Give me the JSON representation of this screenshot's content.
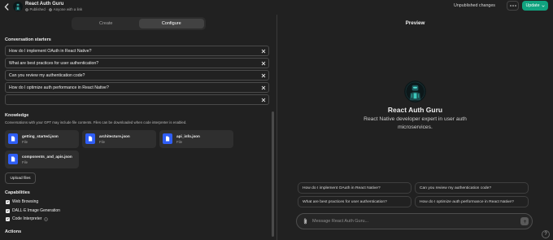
{
  "header": {
    "back_icon": "chevron-left-icon",
    "title": "React Auth Guru",
    "status": "Published",
    "separator": "·",
    "visibility": "Anyone with a link",
    "unpublished_label": "Unpublished changes",
    "more_icon": "ellipsis-icon",
    "update_label": "Update"
  },
  "tabs": [
    {
      "label": "Create",
      "active": false
    },
    {
      "label": "Configure",
      "active": true
    }
  ],
  "starters": {
    "heading": "Conversation starters",
    "items": [
      "How do I implement OAuth in React Native?",
      "What are best practices for user authentication?",
      "Can you review my authentication code?",
      "How do I optimize auth performance in React Native?",
      ""
    ]
  },
  "knowledge": {
    "heading": "Knowledge",
    "description": "Conversations with your GPT may include file contents. Files can be downloaded when code interpreter is enabled.",
    "files": [
      {
        "name": "getting_started.json",
        "type": "File"
      },
      {
        "name": "architecture.json",
        "type": "File"
      },
      {
        "name": "api_info.json",
        "type": "File"
      },
      {
        "name": "components_and_apis.json",
        "type": "File"
      }
    ],
    "upload_label": "Upload files"
  },
  "capabilities": {
    "heading": "Capabilities",
    "items": [
      {
        "label": "Web Browsing",
        "checked": true
      },
      {
        "label": "DALL·E Image Generation",
        "checked": true
      },
      {
        "label": "Code Interpreter",
        "checked": true,
        "info_icon": "info-icon"
      }
    ]
  },
  "actions": {
    "heading": "Actions"
  },
  "preview": {
    "heading": "Preview",
    "name": "React Auth Guru",
    "description": "React Native developer expert in user auth microservices.",
    "suggestions": [
      "How do I implement OAuth in React Native?",
      "Can you review my authentication code?",
      "What are best practices for user authentication?",
      "How do I optimize auth performance in React Native?"
    ],
    "input_placeholder": "Message React Auth Guru...",
    "attach_icon": "paperclip-icon",
    "send_icon": "arrow-up-icon"
  },
  "help_label": "?",
  "colors": {
    "background": "#212121",
    "accent": "#10a37f",
    "file_icon": "#2f5ef5",
    "text": "#ececec",
    "muted": "#9b9b9b"
  }
}
